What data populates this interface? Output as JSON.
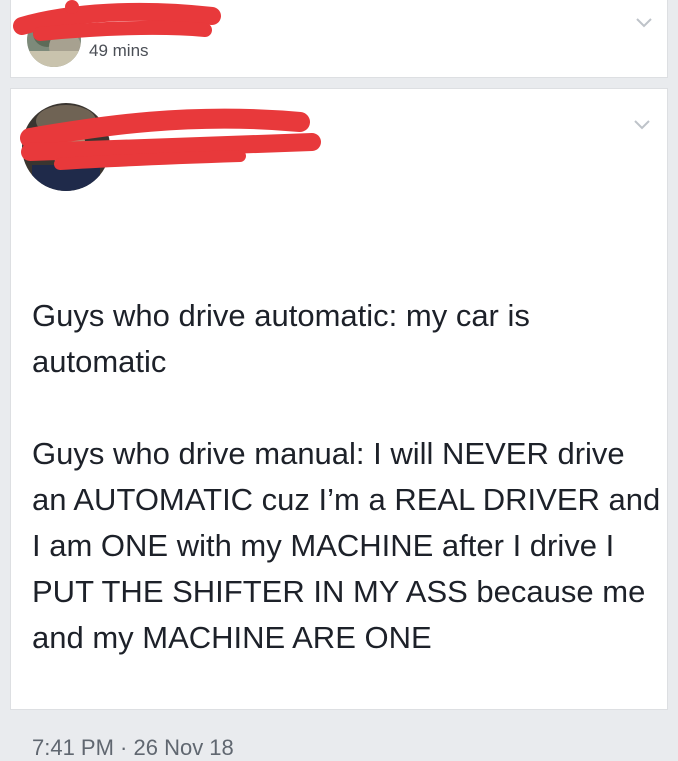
{
  "posts": [
    {
      "timestamp": "49 mins",
      "avatar_icon": "user-avatar",
      "menu_icon": "chevron-down-icon"
    },
    {
      "avatar_icon": "user-avatar",
      "menu_icon": "chevron-down-icon",
      "paragraphs": [
        "Guys who drive automatic: my car is automatic",
        "Guys who drive manual: I will NEVER drive an AUTOMATIC cuz I’m a REAL DRIVER and I am ONE with my MACHINE after I drive I PUT THE SHIFTER IN MY ASS because me and my MACHINE ARE ONE"
      ],
      "footer_time": "7:41 PM · 26 Nov 18"
    }
  ],
  "colors": {
    "background": "#e9ebee",
    "card": "#ffffff",
    "text": "#1d2129",
    "meta": "#606770",
    "redaction": "#e8393b"
  }
}
